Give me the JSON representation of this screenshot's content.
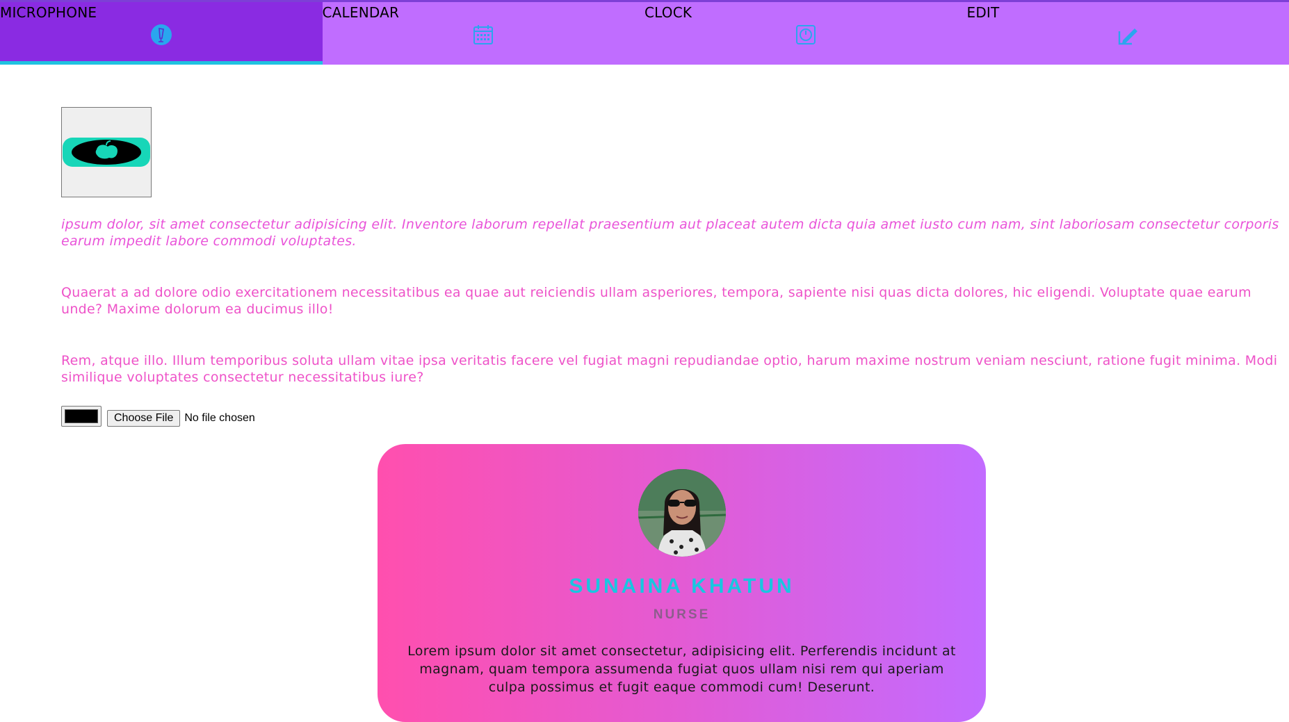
{
  "nav": {
    "tabs": [
      {
        "label": "MICROPHONE",
        "icon": "microphone-icon"
      },
      {
        "label": "CALENDAR",
        "icon": "calendar-icon"
      },
      {
        "label": "CLOCK",
        "icon": "clock-icon"
      },
      {
        "label": "EDIT",
        "icon": "edit-icon"
      }
    ],
    "active_tab": "MICROPHONE",
    "colors": {
      "bar": "#c06dff",
      "active": "#8a2be2",
      "indicator": "#1fc3e0",
      "icon": "#2aa6ee"
    }
  },
  "main": {
    "logo_icon": "apple-logo-icon",
    "paragraphs": [
      "ipsum dolor, sit amet consectetur adipisicing elit. Inventore laborum repellat praesentium aut placeat autem dicta quia amet iusto cum nam, sint laboriosam consectetur corporis earum impedit labore commodi voluptates.",
      "Quaerat a ad dolore odio exercitationem necessitatibus ea quae aut reiciendis ullam asperiores, tempora, sapiente nisi quas dicta dolores, hic eligendi. Voluptate quae earum unde? Maxime dolorum ea ducimus illo!",
      "Rem, atque illo. Illum temporibus soluta ullam vitae ipsa veritatis facere vel fugiat magni repudiandae optio, harum maxime nostrum veniam nesciunt, ratione fugit minima. Modi similique voluptates consectetur necessitatibus iure?"
    ],
    "color_input_value": "#000000",
    "file_button_label": "Choose File",
    "file_status": "No file chosen"
  },
  "profile_card": {
    "name": "SUNAINA KHATUN",
    "role": "NURSE",
    "description": "Lorem ipsum dolor sit amet consectetur, adipisicing elit. Perferendis incidunt at magnam, quam tempora assumenda fugiat quos ullam nisi rem qui aperiam culpa possimus et fugit eaque commodi cum! Deserunt."
  }
}
